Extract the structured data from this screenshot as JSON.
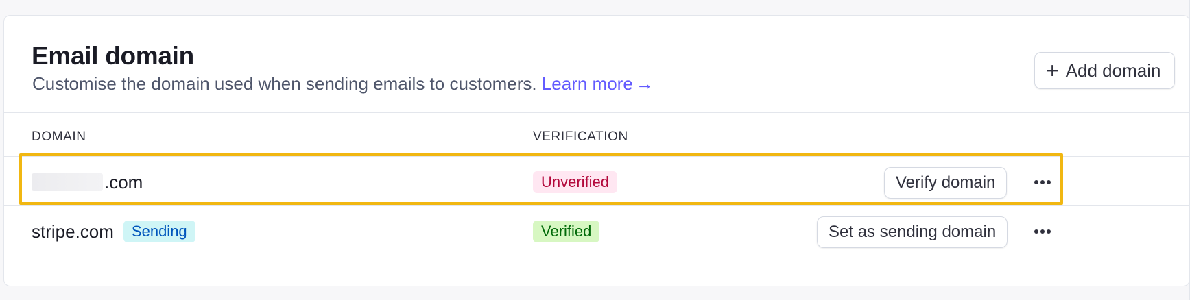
{
  "section": {
    "title": "Email domain",
    "description": "Customise the domain used when sending emails to customers.",
    "learn_more": "Learn more",
    "learn_more_arrow": "→",
    "add_button": "Add domain"
  },
  "table": {
    "columns": [
      "DOMAIN",
      "VERIFICATION"
    ],
    "rows": [
      {
        "domain_suffix": ".com",
        "badge": "",
        "status": "Unverified",
        "action": "Verify domain"
      },
      {
        "domain_suffix": "stripe.com",
        "badge": "Sending",
        "status": "Verified",
        "action": "Set as sending domain"
      }
    ]
  },
  "colors": {
    "accent": "#635bff",
    "highlight": "#f1b711",
    "unverified": "#b3093c",
    "verified": "#006908",
    "sending": "#0055bc"
  }
}
